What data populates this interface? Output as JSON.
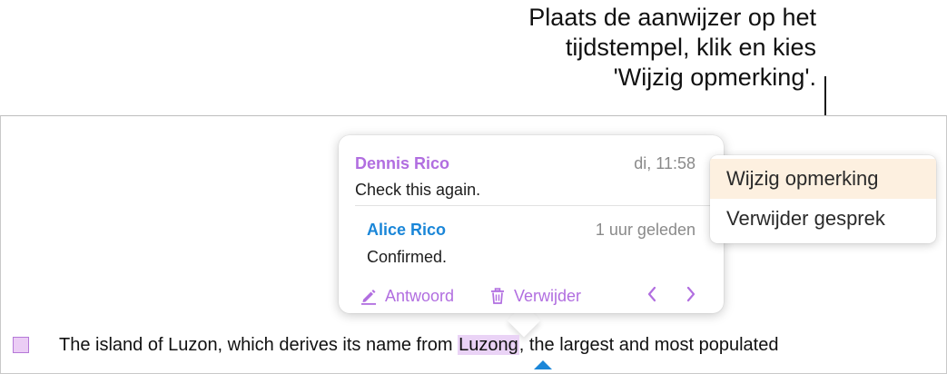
{
  "callout": {
    "line1": "Plaats de aanwijzer op het",
    "line2": "tijdstempel, klik en kies",
    "line3": "'Wijzig opmerking'."
  },
  "comment_popover": {
    "comments": [
      {
        "author": "Dennis Rico",
        "time": "di, 11:58",
        "text": "Check this again."
      },
      {
        "author": "Alice Rico",
        "time": "1 uur geleden",
        "text": "Confirmed."
      }
    ],
    "actions": {
      "reply_label": "Antwoord",
      "delete_label": "Verwijder"
    },
    "icons": {
      "reply": "pencil-icon",
      "delete": "trash-icon",
      "prev": "chevron-left-icon",
      "next": "chevron-right-icon"
    }
  },
  "context_menu": {
    "items": [
      {
        "label": "Wijzig opmerking",
        "selected": true
      },
      {
        "label": "Verwijder gesprek",
        "selected": false
      }
    ]
  },
  "document": {
    "text_before": "The island of Luzon, which derives its name from ",
    "highlighted_word": "Luzong",
    "text_after": ", the largest and most populated"
  },
  "colors": {
    "accent_purple": "#b16ee0",
    "accent_blue": "#1a86d8",
    "highlight": "#ead3f6",
    "menu_selected": "#fdf0e0"
  }
}
